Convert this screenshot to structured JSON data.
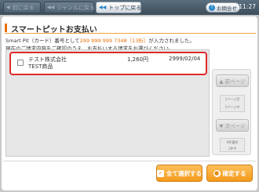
{
  "nav": {
    "prev_label": "前に戻る",
    "genre_label": "ジャンルに戻る",
    "top_label": "トップに戻る",
    "help_label": "お問合せ",
    "help_icon": "?",
    "clock": "11:27"
  },
  "page": {
    "title": "スマートピットお支払い",
    "info_line1_prefix": "Smart Pit（カード）番号として",
    "card_number": "299 999 999 7348（13桁）",
    "info_line1_suffix": "が入力されました。",
    "info_line2": "現在のご請求内容をご確認のうえ、お支払いする請求をお選びください。"
  },
  "bills": [
    {
      "company": "テスト株式会社",
      "product": "TEST商品",
      "amount": "1,260円",
      "due_date": "2999/02/04"
    }
  ],
  "pager": {
    "prev_label": "▲ 前ページ",
    "next_label": "▼ 次ページ",
    "page_current": "1ページ目",
    "page_total": "1ページ中",
    "selected_label": "0件選択",
    "selected_total": "1件中"
  },
  "actions": {
    "select_all_label": "全て選択する",
    "confirm_label": "確定する"
  },
  "colors": {
    "accent": "#e8710a",
    "highlight_border": "#df2a2a",
    "topbar": "#3c4d5a"
  }
}
